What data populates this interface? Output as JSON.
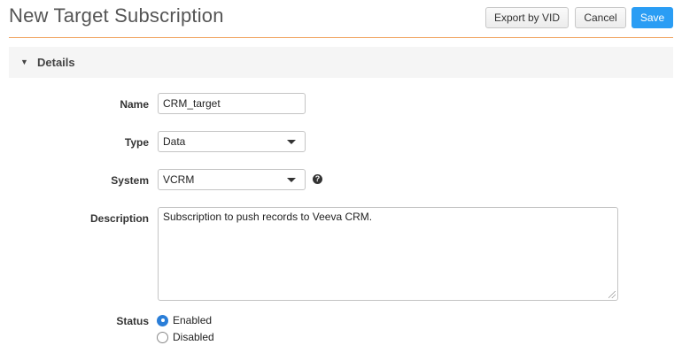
{
  "header": {
    "title": "New Target Subscription",
    "export_label": "Export by VID",
    "cancel_label": "Cancel",
    "save_label": "Save"
  },
  "section": {
    "caret_glyph": "▼",
    "title": "Details"
  },
  "form": {
    "name": {
      "label": "Name",
      "value": "CRM_target"
    },
    "type": {
      "label": "Type",
      "value": "Data"
    },
    "system": {
      "label": "System",
      "value": "VCRM",
      "help_glyph": "?"
    },
    "description": {
      "label": "Description",
      "value": "Subscription to push records to Veeva CRM."
    },
    "status": {
      "label": "Status",
      "options": [
        {
          "label": "Enabled",
          "selected": true
        },
        {
          "label": "Disabled",
          "selected": false
        }
      ]
    }
  },
  "icons": [
    "caret-down-icon",
    "dropdown-arrow-icon",
    "help-icon",
    "radio-icon"
  ],
  "colors": {
    "accent": "#2a9df4",
    "title_rule": "#f0a35e",
    "section_bg": "#f5f5f5",
    "radio_selected": "#2a7ed8"
  }
}
